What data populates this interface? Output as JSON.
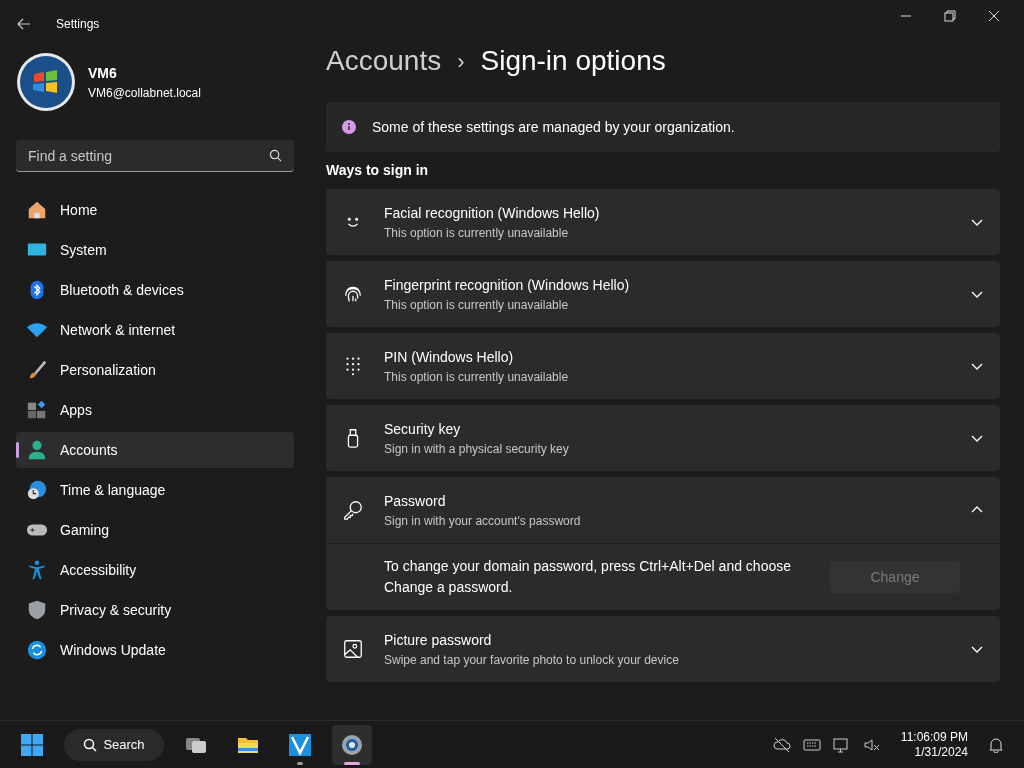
{
  "window": {
    "title": "Settings"
  },
  "user": {
    "name": "VM6",
    "email": "VM6@collabnet.local"
  },
  "search": {
    "placeholder": "Find a setting"
  },
  "sidebar": {
    "items": [
      {
        "label": "Home",
        "selected": false
      },
      {
        "label": "System",
        "selected": false
      },
      {
        "label": "Bluetooth & devices",
        "selected": false
      },
      {
        "label": "Network & internet",
        "selected": false
      },
      {
        "label": "Personalization",
        "selected": false
      },
      {
        "label": "Apps",
        "selected": false
      },
      {
        "label": "Accounts",
        "selected": true
      },
      {
        "label": "Time & language",
        "selected": false
      },
      {
        "label": "Gaming",
        "selected": false
      },
      {
        "label": "Accessibility",
        "selected": false
      },
      {
        "label": "Privacy & security",
        "selected": false
      },
      {
        "label": "Windows Update",
        "selected": false
      }
    ]
  },
  "breadcrumb": {
    "parent": "Accounts",
    "separator": "›",
    "current": "Sign-in options"
  },
  "notice": "Some of these settings are managed by your organization.",
  "section_title": "Ways to sign in",
  "options": [
    {
      "title": "Facial recognition (Windows Hello)",
      "subtitle": "This option is currently unavailable",
      "expanded": false
    },
    {
      "title": "Fingerprint recognition (Windows Hello)",
      "subtitle": "This option is currently unavailable",
      "expanded": false
    },
    {
      "title": "PIN (Windows Hello)",
      "subtitle": "This option is currently unavailable",
      "expanded": false
    },
    {
      "title": "Security key",
      "subtitle": "Sign in with a physical security key",
      "expanded": false
    },
    {
      "title": "Password",
      "subtitle": "Sign in with your account's password",
      "expanded": true,
      "detail": "To change your domain password, press Ctrl+Alt+Del and choose Change a password.",
      "button": {
        "label": "Change",
        "disabled": true
      }
    },
    {
      "title": "Picture password",
      "subtitle": "Swipe and tap your favorite photo to unlock your device",
      "expanded": false
    }
  ],
  "taskbar": {
    "search_label": "Search",
    "apps": [
      {
        "running": false,
        "selected": false
      },
      {
        "running": false,
        "selected": false
      },
      {
        "running": true,
        "selected": false
      },
      {
        "running": true,
        "selected": true
      }
    ],
    "time": "11:06:09 PM",
    "date": "1/31/2024"
  }
}
